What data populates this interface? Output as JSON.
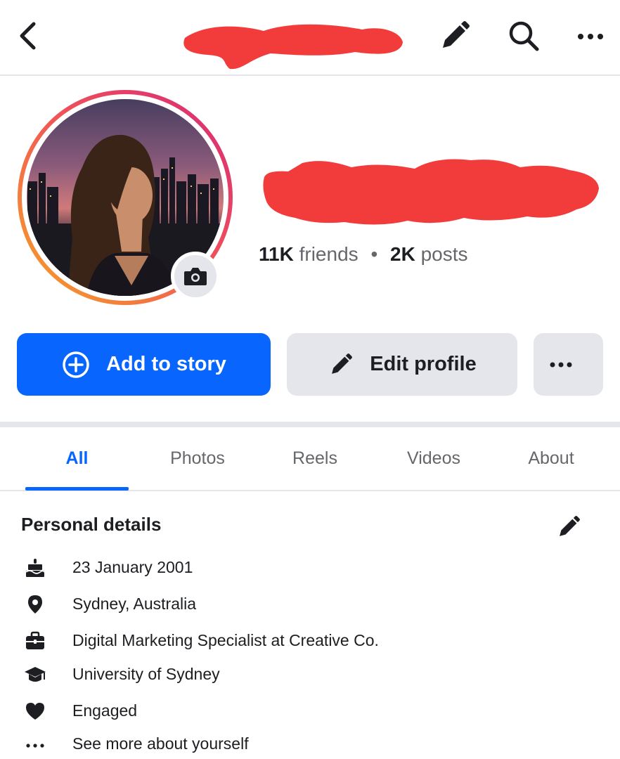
{
  "header": {
    "back_icon": "back-arrow-icon",
    "edit_icon": "pencil-icon",
    "search_icon": "search-icon",
    "more_icon": "more-horizontal-icon"
  },
  "profile": {
    "camera_icon": "camera-icon",
    "friends_count": "11K",
    "friends_label": "friends",
    "separator": "•",
    "posts_count": "2K",
    "posts_label": "posts"
  },
  "actions": {
    "add_story_label": "Add to story",
    "add_story_icon": "plus-circle-icon",
    "edit_profile_label": "Edit profile",
    "edit_profile_icon": "pencil-icon",
    "more_icon": "more-horizontal-icon"
  },
  "tabs": [
    {
      "label": "All",
      "active": true
    },
    {
      "label": "Photos",
      "active": false
    },
    {
      "label": "Reels",
      "active": false
    },
    {
      "label": "Videos",
      "active": false
    },
    {
      "label": "About",
      "active": false
    }
  ],
  "personal_details": {
    "title": "Personal details",
    "edit_icon": "pencil-icon",
    "items": [
      {
        "icon": "birthday-cake-icon",
        "text": "23 January 2001"
      },
      {
        "icon": "location-pin-icon",
        "text": "Sydney, Australia"
      },
      {
        "icon": "briefcase-icon",
        "text": "Digital Marketing Specialist at Creative Co."
      },
      {
        "icon": "graduation-cap-icon",
        "text": "University of Sydney"
      },
      {
        "icon": "heart-icon",
        "text": "Engaged"
      },
      {
        "icon": "more-horizontal-icon",
        "text": "See more about yourself"
      }
    ]
  },
  "colors": {
    "accent": "#0866ff",
    "button_gray": "#e4e6eb",
    "redaction": "#f23b3b",
    "story_ring_start": "#f7a325",
    "story_ring_end": "#e1306c"
  }
}
